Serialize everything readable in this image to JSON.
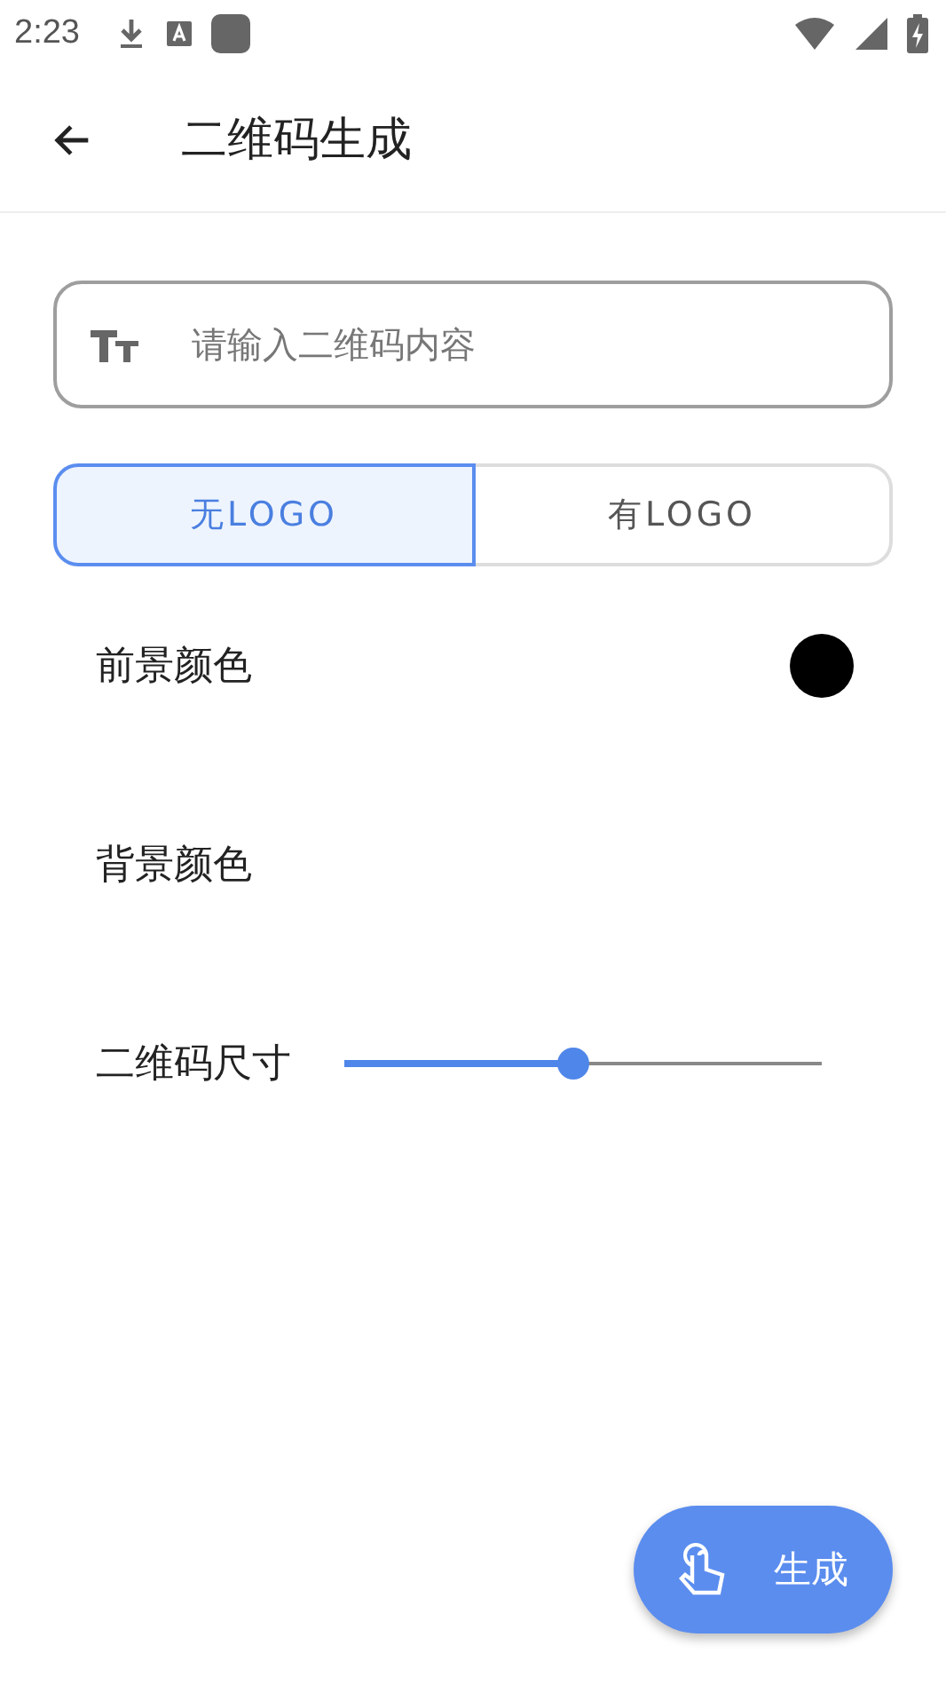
{
  "status_bar": {
    "time": "2:23"
  },
  "app_bar": {
    "title": "二维码生成"
  },
  "input": {
    "placeholder": "请输入二维码内容"
  },
  "logo_options": [
    {
      "label": "无LOGO",
      "selected": true
    },
    {
      "label": "有LOGO",
      "selected": false
    }
  ],
  "settings": [
    {
      "kind": "color",
      "label": "前景颜色",
      "color": "#000000"
    },
    {
      "kind": "color",
      "label": "背景颜色"
    },
    {
      "kind": "slider",
      "label": "二维码尺寸",
      "level": 0.48
    }
  ],
  "generate_button": {
    "label": "生成"
  }
}
